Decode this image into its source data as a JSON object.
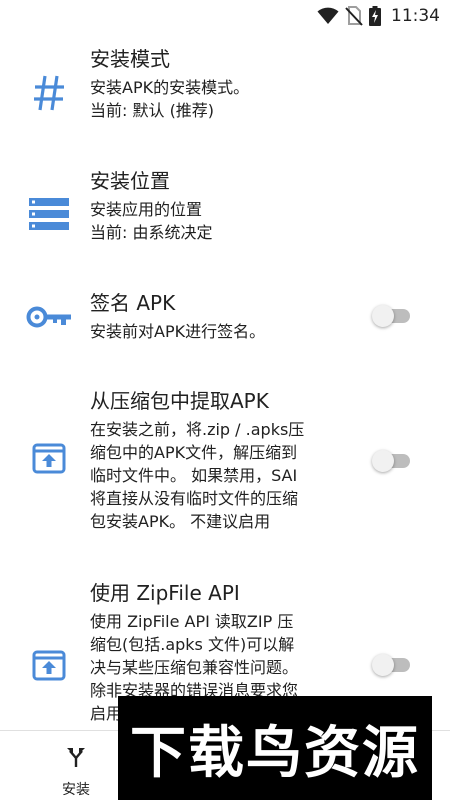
{
  "status_bar": {
    "time": "11:34",
    "icons": [
      "wifi-icon",
      "no-sim-icon",
      "battery-charging-icon"
    ]
  },
  "settings": [
    {
      "title": "安装模式",
      "description": "安装APK的安装模式。\n当前: 默认 (推荐)",
      "icon": "hash-icon",
      "has_toggle": false
    },
    {
      "title": "安装位置",
      "description": "安装应用的位置\n当前: 由系统决定",
      "icon": "storage-list-icon",
      "has_toggle": false
    },
    {
      "title": "签名 APK",
      "description": "安装前对APK进行签名。",
      "icon": "key-icon",
      "has_toggle": true,
      "toggle_on": false
    },
    {
      "title": "从压缩包中提取APK",
      "description": "在安装之前，将.zip / .apks压\n缩包中的APK文件，解压缩到\n临时文件中。 如果禁用，SAI\n将直接从没有临时文件的压缩\n包安装APK。 不建议启用",
      "icon": "unarchive-icon",
      "has_toggle": true,
      "toggle_on": false
    },
    {
      "title": "使用 ZipFile API",
      "description": "使用 ZipFile API 读取ZIP 压\n缩包(包括.apks 文件)可以解\n决与某些压缩包兼容性问题。\n除非安装器的错误消息要求您\n启用",
      "icon": "unarchive-icon",
      "has_toggle": true,
      "toggle_on": false
    }
  ],
  "bottom_nav": {
    "install_label": "安装",
    "install_icon": "merge-arrow-icon"
  },
  "watermark": {
    "text": "下载鸟资源"
  },
  "colors": {
    "accent": "#4a8ad8",
    "toggle_track": "#bdbdbd",
    "toggle_thumb": "#f1f1f1"
  }
}
